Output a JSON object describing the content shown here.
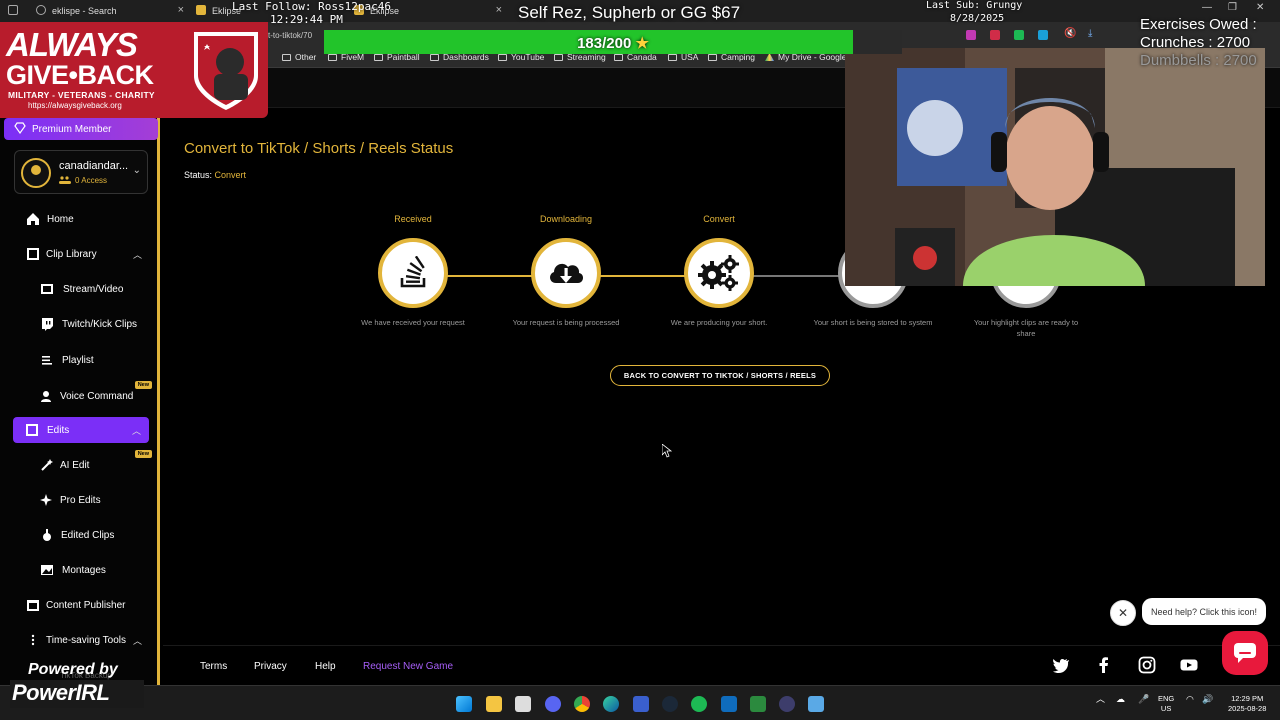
{
  "browser": {
    "tabs": [
      {
        "title": "eklispe - Search"
      },
      {
        "title": "Eklipse"
      },
      {
        "title": "Eklipse"
      }
    ],
    "url_fragment": "t-to-tiktok/70",
    "bookmarks": [
      "Other",
      "FiveM",
      "Paintball",
      "Dashboards",
      "YouTube",
      "Streaming",
      "Canada",
      "USA",
      "Camping",
      "My Drive - Google..."
    ]
  },
  "sidebar": {
    "premium_label": "Premium Member",
    "profile": {
      "name": "canadiandar...",
      "access": "0 Access"
    },
    "items": [
      {
        "label": "Home"
      },
      {
        "label": "Clip Library"
      },
      {
        "label": "Stream/Video"
      },
      {
        "label": "Twitch/Kick Clips"
      },
      {
        "label": "Playlist"
      },
      {
        "label": "Voice Command",
        "badge": "New"
      },
      {
        "label": "Edits"
      },
      {
        "label": "AI Edit",
        "badge": "New"
      },
      {
        "label": "Pro Edits"
      },
      {
        "label": "Edited Clips"
      },
      {
        "label": "Montages"
      },
      {
        "label": "Content Publisher"
      },
      {
        "label": "Time-saving Tools"
      },
      {
        "label": "TikTok Backup"
      }
    ]
  },
  "main": {
    "title": "Convert to TikTok / Shorts / Reels Status",
    "status_label": "Status:",
    "status_value": "Convert",
    "steps": [
      {
        "label": "Received",
        "desc": "We have received your request"
      },
      {
        "label": "Downloading",
        "desc": "Your request is being processed"
      },
      {
        "label": "Convert",
        "desc": "We are producing your short."
      },
      {
        "label": "",
        "desc": "Your short is being stored to system"
      },
      {
        "label": "",
        "desc": "Your highlight clips are ready to share"
      }
    ],
    "back_button": "BACK TO CONVERT TO TIKTOK / SHORTS / REELS"
  },
  "footer": {
    "links": [
      "Terms",
      "Privacy",
      "Help",
      "Request New Game"
    ]
  },
  "help_widget": {
    "bubble": "Need help? Click this icon!"
  },
  "overlay": {
    "last_follow": "Last Follow: Ross12pac46",
    "clock": "12:29:44 PM",
    "headline": "Self Rez, Supherb or GG $67",
    "last_sub": "Last Sub: Grungy",
    "last_sub_date": "8/28/2025",
    "goal_text": "183/200",
    "goal_progress": 0.915,
    "exercises_title": "Exercises Owed :",
    "exercises_line1": "Crunches : 2700",
    "exercises_line2": "Dumbbells : 2700",
    "agb_line1": "ALWAYS",
    "agb_line2": "GIVE•BACK",
    "agb_line3": "MILITARY - VETERANS - CHARITY",
    "agb_url": "https://alwaysgiveback.org",
    "powered_by": "Powered by",
    "powerirl": "PowerIRL"
  },
  "taskbar": {
    "lang": "ENG",
    "region": "US",
    "time": "12:29 PM",
    "date": "2025-08-28"
  },
  "colors": {
    "accent": "#e2b53b",
    "purple": "#7b2ff7",
    "help_red": "#e8193c",
    "goal_green": "#22c42a"
  }
}
